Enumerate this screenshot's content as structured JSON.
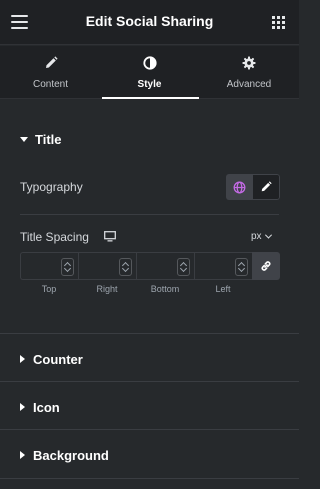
{
  "header": {
    "title": "Edit Social Sharing",
    "menu_icon": "hamburger-menu-icon",
    "apps_icon": "grid-apps-icon"
  },
  "tabs": [
    {
      "label": "Content",
      "icon": "pencil-icon",
      "active": false
    },
    {
      "label": "Style",
      "icon": "half-circle-contrast-icon",
      "active": true
    },
    {
      "label": "Advanced",
      "icon": "gear-icon",
      "active": false
    }
  ],
  "title_section": {
    "label": "Title",
    "expanded": true,
    "typography": {
      "label": "Typography",
      "globe_icon": "globe-icon",
      "edit_icon": "pencil-icon"
    },
    "title_spacing": {
      "label": "Title Spacing",
      "device_icon": "desktop-icon",
      "unit": "px",
      "fields": [
        {
          "label": "Top",
          "value": ""
        },
        {
          "label": "Right",
          "value": ""
        },
        {
          "label": "Bottom",
          "value": ""
        },
        {
          "label": "Left",
          "value": ""
        }
      ],
      "link_icon": "link-icon"
    }
  },
  "collapsed_sections": [
    {
      "label": "Counter"
    },
    {
      "label": "Icon"
    },
    {
      "label": "Background"
    }
  ],
  "colors": {
    "panel_bg": "#26292c",
    "header_bg": "#1f2124",
    "globe_accent": "#c36ae4",
    "text": "#d5d8dc"
  }
}
